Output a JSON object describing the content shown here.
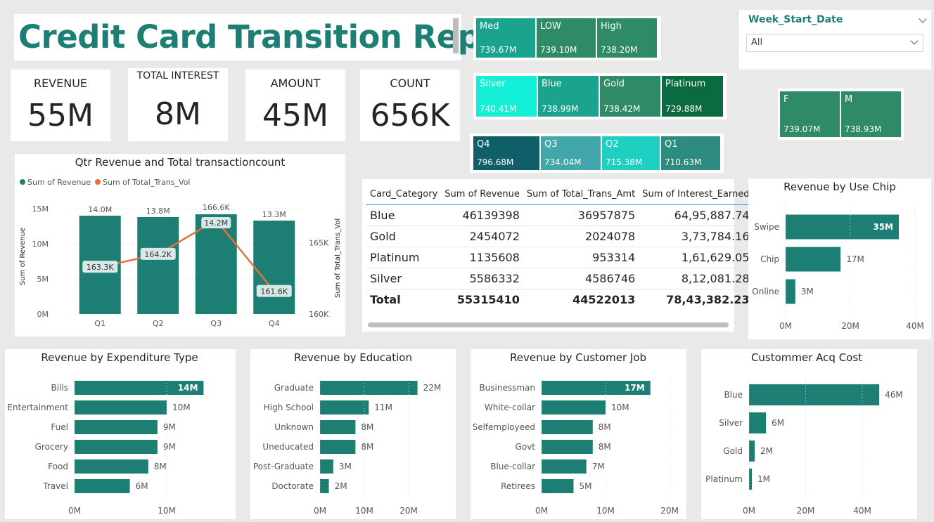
{
  "report_title": "Credit Card Transition Report",
  "kpis": [
    {
      "label": "REVENUE",
      "value": "55M"
    },
    {
      "label": "TOTAL INTEREST",
      "value": "8M"
    },
    {
      "label": "AMOUNT",
      "value": "45M"
    },
    {
      "label": "COUNT",
      "value": "656K"
    }
  ],
  "treemaps": {
    "income_group": [
      {
        "label": "Med",
        "value": "739.67M",
        "color": "#1aa38d"
      },
      {
        "label": "LOW",
        "value": "739.10M",
        "color": "#2e8b66"
      },
      {
        "label": "High",
        "value": "738.20M",
        "color": "#2e8b66"
      }
    ],
    "card_category": [
      {
        "label": "Silver",
        "value": "740.41M",
        "color": "#14f0d8"
      },
      {
        "label": "Blue",
        "value": "738.99M",
        "color": "#1aa38d"
      },
      {
        "label": "Gold",
        "value": "738.42M",
        "color": "#2e8b66"
      },
      {
        "label": "Platinum",
        "value": "729.88M",
        "color": "#0b6b40"
      }
    ],
    "quarter": [
      {
        "label": "Q4",
        "value": "796.68M",
        "color": "#0f5f68"
      },
      {
        "label": "Q3",
        "value": "734.04M",
        "color": "#41a7ab"
      },
      {
        "label": "Q2",
        "value": "715.38M",
        "color": "#1fd0c2"
      },
      {
        "label": "Q1",
        "value": "710.63M",
        "color": "#2e8b80"
      }
    ],
    "gender": [
      {
        "label": "F",
        "value": "739.07M",
        "color": "#2e8b66"
      },
      {
        "label": "M",
        "value": "738.93M",
        "color": "#2e8b66"
      }
    ]
  },
  "slicer": {
    "title": "Week_Start_Date",
    "value": "All"
  },
  "table": {
    "headers": [
      "Card_Category",
      "Sum of Revenue",
      "Sum of Total_Trans_Amt",
      "Sum of Interest_Earned"
    ],
    "rows": [
      [
        "Blue",
        "46139398",
        "36957875",
        "64,95,887.74"
      ],
      [
        "Gold",
        "2454072",
        "2024078",
        "3,73,784.16"
      ],
      [
        "Platinum",
        "1135608",
        "953314",
        "1,61,629.05"
      ],
      [
        "Silver",
        "5586332",
        "4586746",
        "8,12,081.28"
      ]
    ],
    "total": [
      "Total",
      "55315410",
      "44522013",
      "78,43,382.23"
    ]
  },
  "chart_data": [
    {
      "id": "qtr",
      "type": "bar",
      "title": "Qtr Revenue and Total transactioncount",
      "legend": [
        "Sum of Revenue",
        "Sum of Total_Trans_Vol"
      ],
      "legend_position": "top-left",
      "categories": [
        "Q1",
        "Q2",
        "Q3",
        "Q4"
      ],
      "series": [
        {
          "name": "Sum of Revenue",
          "type": "bar",
          "axis": "left",
          "values": [
            14.0,
            13.8,
            14.2,
            13.3
          ],
          "labels": [
            "14.0M",
            "13.8M",
            "14.2M",
            "13.3M"
          ],
          "color": "#1d7f73"
        },
        {
          "name": "Sum of Total_Trans_Vol",
          "type": "line",
          "axis": "right",
          "values": [
            163.3,
            164.2,
            166.6,
            161.6
          ],
          "labels": [
            "163.3K",
            "164.2K",
            "166.6K",
            "161.6K"
          ],
          "color": "#e8703a"
        }
      ],
      "y_left": {
        "label": "Sum of Revenue",
        "ticks": [
          "0M",
          "5M",
          "10M",
          "15M"
        ],
        "range": [
          0,
          15
        ]
      },
      "y_right": {
        "label": "Sum of Total_Trans_Vol",
        "ticks": [
          "160K",
          "165K"
        ],
        "range": [
          160,
          167.4
        ]
      },
      "grid": true
    },
    {
      "id": "usechip",
      "type": "bar",
      "orientation": "horizontal",
      "title": "Revenue by Use Chip",
      "categories": [
        "Swipe",
        "Chip",
        "Online"
      ],
      "values": [
        35,
        17,
        3
      ],
      "labels": [
        "35M",
        "17M",
        "3M"
      ],
      "xticks": [
        "0M",
        "20M",
        "40M"
      ],
      "xlim": [
        0,
        40
      ]
    },
    {
      "id": "exp",
      "type": "bar",
      "orientation": "horizontal",
      "title": "Revenue by Expenditure Type",
      "categories": [
        "Bills",
        "Entertainment",
        "Fuel",
        "Grocery",
        "Food",
        "Travel"
      ],
      "values": [
        14,
        10,
        9,
        9,
        8,
        6
      ],
      "labels": [
        "14M",
        "10M",
        "9M",
        "9M",
        "8M",
        "6M"
      ],
      "xticks": [
        "0M",
        "10M"
      ],
      "xlim": [
        0,
        10
      ]
    },
    {
      "id": "edu",
      "type": "bar",
      "orientation": "horizontal",
      "title": "Revenue by Education",
      "categories": [
        "Graduate",
        "High School",
        "Unknown",
        "Uneducated",
        "Post-Graduate",
        "Doctorate"
      ],
      "values": [
        22,
        11,
        8,
        8,
        3,
        2
      ],
      "labels": [
        "22M",
        "11M",
        "8M",
        "8M",
        "3M",
        "2M"
      ],
      "xticks": [
        "0M",
        "10M",
        "20M"
      ],
      "xlim": [
        0,
        20
      ]
    },
    {
      "id": "job",
      "type": "bar",
      "orientation": "horizontal",
      "title": "Revenue by Customer Job",
      "categories": [
        "Businessman",
        "White-collar",
        "Selfemployeed",
        "Govt",
        "Blue-collar",
        "Retirees"
      ],
      "values": [
        17,
        10,
        8,
        8,
        7,
        5
      ],
      "labels": [
        "17M",
        "10M",
        "8M",
        "8M",
        "7M",
        "5M"
      ],
      "xticks": [
        "0M",
        "10M",
        "20M"
      ],
      "xlim": [
        0,
        20
      ]
    },
    {
      "id": "acq",
      "type": "bar",
      "orientation": "horizontal",
      "title": "Custommer Acq Cost",
      "categories": [
        "Blue",
        "Silver",
        "Gold",
        "Platinum"
      ],
      "values": [
        46,
        6,
        2,
        1
      ],
      "labels": [
        "46M",
        "6M",
        "2M",
        "1M"
      ],
      "xticks": [
        "0M",
        "20M",
        "40M"
      ],
      "xlim": [
        0,
        40
      ]
    }
  ]
}
